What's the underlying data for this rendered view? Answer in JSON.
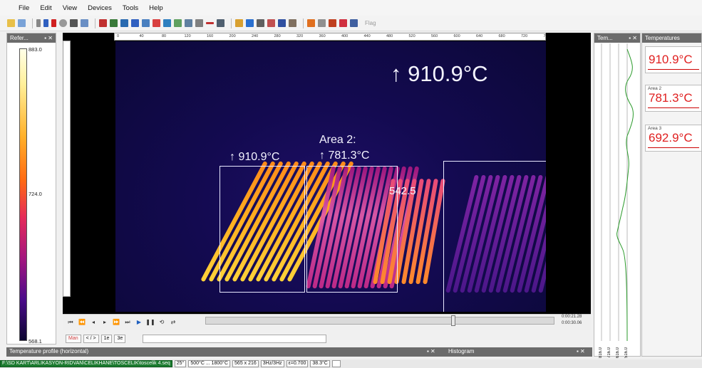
{
  "menu": [
    "File",
    "Edit",
    "View",
    "Devices",
    "Tools",
    "Help"
  ],
  "toolbar": {
    "flag_label": "Flag"
  },
  "reference_pane": {
    "title": "Refer...",
    "scale_max": "883.0",
    "scale_mid": "724.0",
    "scale_min": "568.1"
  },
  "ruler_top": [
    "0",
    "40",
    "80",
    "120",
    "160",
    "200",
    "240",
    "280",
    "320",
    "360",
    "400",
    "440",
    "480",
    "520",
    "560",
    "600",
    "640",
    "680",
    "720",
    "760"
  ],
  "thermal": {
    "max_readout": "↑ 910.9°C",
    "area1_readout": "↑ 910.9°C",
    "area2_title": "Area 2:",
    "area2_readout": "↑ 781.3°C",
    "spot_value": "542.5"
  },
  "playback": {
    "time_current": "0:00:21.28",
    "time_total": "0:00:30.06"
  },
  "controls": {
    "btn_man": "Man",
    "btn_nav": "< / >",
    "btn_1e": "1e",
    "btn_3e": "3e"
  },
  "bottom": {
    "profile_title": "Temperature profile (horizontal)",
    "histogram_title": "Histogram"
  },
  "profile_pane": {
    "title": "Tem...",
    "axis_labels": [
      "816.0",
      "716.0",
      "616.0",
      "516.0"
    ]
  },
  "temps_pane": {
    "title": "Temperatures",
    "cards": [
      {
        "name": "",
        "value": "910.9°C"
      },
      {
        "name": "Area 2",
        "value": "781.3°C"
      },
      {
        "name": "Area 3",
        "value": "692.9°C"
      }
    ]
  },
  "status": {
    "path": "F:\\SD KART\\ARLIKASYON-RIDVAN\\CELIKHANE\\TOSCELIK\\toscelik 4.seq",
    "ambient": "25°",
    "range": "500°C ... 1800°C",
    "resolution": "565 x 216",
    "freq": "3Hz/3Hz",
    "emissivity": "ε=0.700",
    "reflected": "38.3°C"
  },
  "colors": {
    "accent_red": "#e02020",
    "status_green": "#1a7a2e",
    "pane_title": "#6b6b6b"
  }
}
